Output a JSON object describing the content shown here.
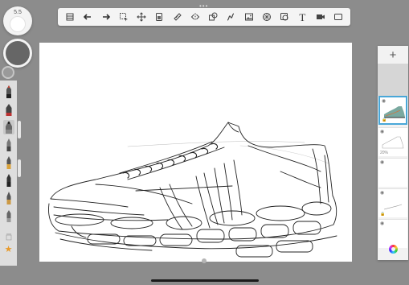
{
  "toolbar": {
    "tools": [
      {
        "name": "gallery",
        "icon": "list-icon"
      },
      {
        "name": "undo",
        "icon": "undo-arrow-icon"
      },
      {
        "name": "redo",
        "icon": "redo-arrow-icon"
      },
      {
        "name": "selection",
        "icon": "selection-icon"
      },
      {
        "name": "transform",
        "icon": "move-icon"
      },
      {
        "name": "fill",
        "icon": "fill-icon"
      },
      {
        "name": "ruler",
        "icon": "ruler-icon"
      },
      {
        "name": "symmetry",
        "icon": "symmetry-icon"
      },
      {
        "name": "shapes",
        "icon": "shapes-icon"
      },
      {
        "name": "curve",
        "icon": "curve-icon"
      },
      {
        "name": "import-image",
        "icon": "image-icon"
      },
      {
        "name": "perspective",
        "icon": "perspective-icon"
      },
      {
        "name": "stamp",
        "icon": "stamp-icon"
      },
      {
        "name": "text",
        "icon": "text-icon",
        "label": "T"
      },
      {
        "name": "video",
        "icon": "camera-icon"
      },
      {
        "name": "fullscreen",
        "icon": "fullscreen-icon"
      }
    ]
  },
  "left_panel": {
    "brush_size": "5.5",
    "opacity_color": "#666666",
    "brushes": [
      "pencil-1",
      "pencil-2",
      "marker-1",
      "pen-1",
      "pen-2",
      "pen-3",
      "brush-1",
      "brush-2",
      "eraser-1"
    ],
    "favorite_icon": "star-icon"
  },
  "layers": {
    "add_label": "+",
    "items": [
      {
        "name": "color-layer",
        "selected": true,
        "badge": ""
      },
      {
        "name": "sketch-layer",
        "selected": false,
        "badge": "20%"
      },
      {
        "name": "empty-layer",
        "selected": false,
        "badge": ""
      },
      {
        "name": "detail-layer",
        "selected": false,
        "badge": ""
      },
      {
        "name": "background-layer",
        "selected": false,
        "badge": ""
      }
    ]
  },
  "colors": {
    "background": "#8c8c8c",
    "panel": "#f2f2f2",
    "selection": "#49a7d8",
    "star": "#e89a2a"
  }
}
